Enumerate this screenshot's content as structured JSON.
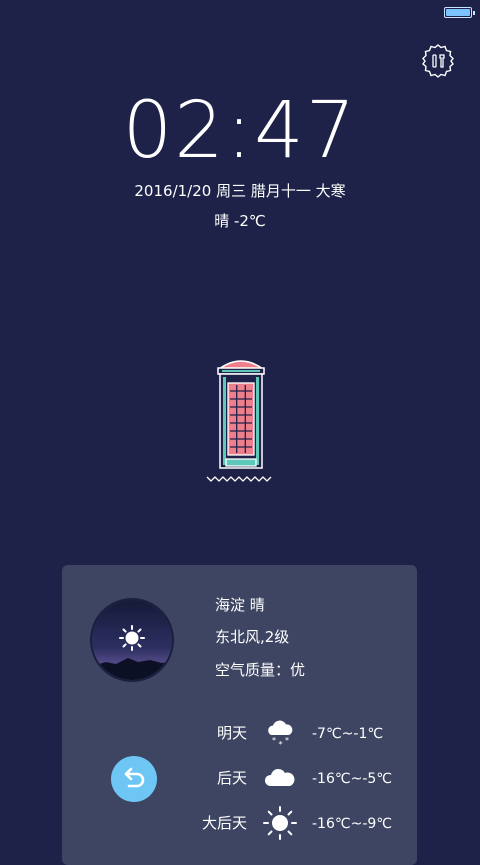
{
  "status_bar": {
    "battery_level": 1.0,
    "battery_color": "#7cc4ff"
  },
  "icons": {
    "tools": "tools-icon",
    "refresh": "refresh-icon",
    "sunny": "sun-icon",
    "snow": "snow-cloud-icon",
    "cloud": "cloud-icon"
  },
  "lockscreen": {
    "time": "02:47",
    "date_line": "2016/1/20  周三  腊月十一 大寒",
    "weather_line": "晴  -2℃"
  },
  "weather_card": {
    "location_line": "海淀  晴",
    "wind_line": "东北风,2级",
    "air_line": "空气质量：优",
    "forecast": [
      {
        "day": "明天",
        "icon": "snow-cloud-icon",
        "temp": "-7℃~-1℃"
      },
      {
        "day": "后天",
        "icon": "cloud-icon",
        "temp": "-16℃~-5℃"
      },
      {
        "day": "大后天",
        "icon": "sun-icon",
        "temp": "-16℃~-9℃"
      }
    ]
  },
  "colors": {
    "background": "#1e2249",
    "card": "#3d4562",
    "accent": "#6ec6f5",
    "booth_pink": "#f07f8e",
    "booth_teal": "#5fc8b8"
  }
}
